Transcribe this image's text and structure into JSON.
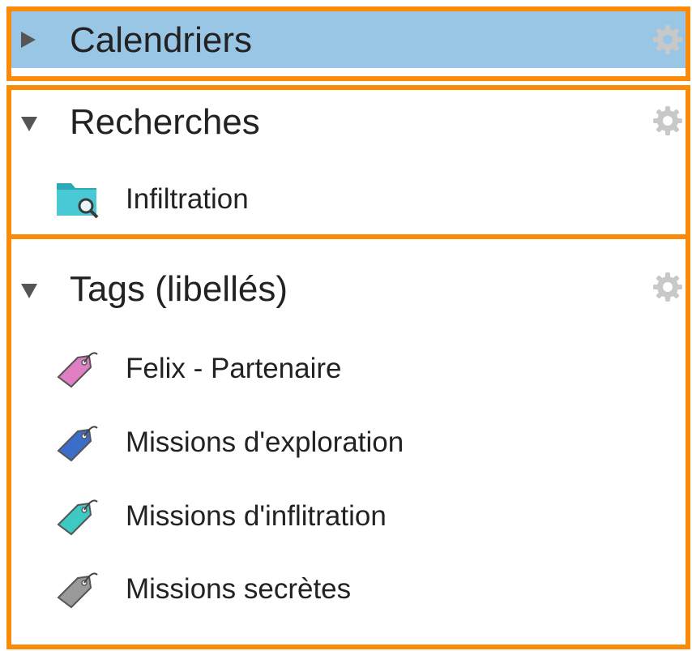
{
  "calendars": {
    "title": "Calendriers",
    "expanded": false,
    "selected": true
  },
  "searches": {
    "title": "Recherches",
    "expanded": true,
    "items": [
      {
        "label": "Infiltration",
        "icon": "search-folder-icon"
      }
    ]
  },
  "tags": {
    "title": "Tags (libellés)",
    "expanded": true,
    "items": [
      {
        "label": "Felix - Partenaire",
        "color": "#e07fc3"
      },
      {
        "label": "Missions d'exploration",
        "color": "#3b6ec9"
      },
      {
        "label": "Missions d'inflitration",
        "color": "#3ec9c3"
      },
      {
        "label": "Missions secrètes",
        "color": "#9a9a9a"
      }
    ]
  },
  "colors": {
    "accent": "#fb8a09",
    "selection": "#9ac6e6"
  }
}
